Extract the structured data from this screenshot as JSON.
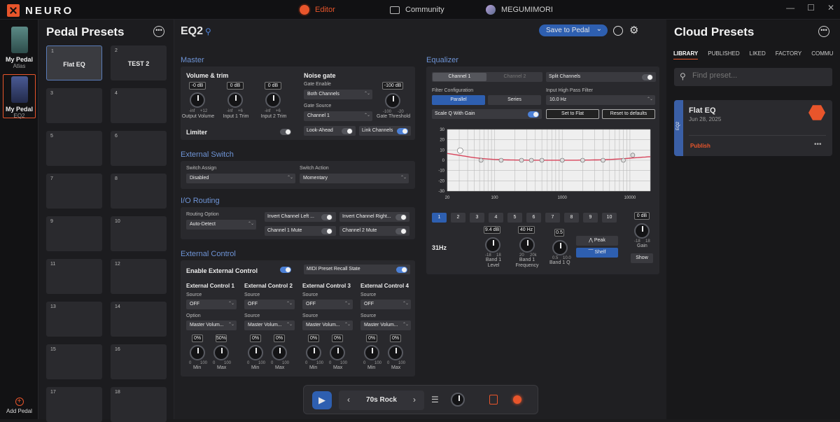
{
  "app": {
    "logo_text": "NEURO",
    "nav": {
      "editor": "Editor",
      "community": "Community",
      "user": "MEGUMIMORI"
    },
    "window": {
      "min": "—",
      "max": "☐",
      "close": "✕"
    }
  },
  "sidebar": {
    "pedals": [
      {
        "name": "My Pedal",
        "sub": "Atlas",
        "color": "#3c6a6a"
      },
      {
        "name": "My Pedal",
        "sub": "EQ2",
        "color": "#2f3c6a"
      }
    ],
    "add_label": "Add Pedal"
  },
  "presets": {
    "title": "Pedal Presets",
    "more": "•••",
    "slots": [
      {
        "n": "1",
        "label": "Flat EQ"
      },
      {
        "n": "2",
        "label": "TEST 2"
      },
      {
        "n": "3",
        "label": ""
      },
      {
        "n": "4",
        "label": ""
      },
      {
        "n": "5",
        "label": ""
      },
      {
        "n": "6",
        "label": ""
      },
      {
        "n": "7",
        "label": ""
      },
      {
        "n": "8",
        "label": ""
      },
      {
        "n": "9",
        "label": ""
      },
      {
        "n": "10",
        "label": ""
      },
      {
        "n": "11",
        "label": ""
      },
      {
        "n": "12",
        "label": ""
      },
      {
        "n": "13",
        "label": ""
      },
      {
        "n": "14",
        "label": ""
      },
      {
        "n": "15",
        "label": ""
      },
      {
        "n": "16",
        "label": ""
      },
      {
        "n": "17",
        "label": ""
      },
      {
        "n": "18",
        "label": ""
      }
    ]
  },
  "header": {
    "title": "EQ2",
    "save": "Save to Pedal",
    "save_arrow": "⌄"
  },
  "master": {
    "title": "Master",
    "vol_title": "Volume & trim",
    "knobs": [
      {
        "value": "-0 dB",
        "label": "Output Volume",
        "min": "-inf",
        "max": "+12"
      },
      {
        "value": "0 dB",
        "label": "Input 1 Trim",
        "min": "-inf",
        "max": "+6"
      },
      {
        "value": "0 dB",
        "label": "Input 2 Trim",
        "min": "-inf",
        "max": "+6"
      }
    ],
    "limiter": "Limiter",
    "noise_gate": "Noise gate",
    "gate_enable": "Gate Enable",
    "gate_enable_val": "Both Channels",
    "gate_source": "Gate Source",
    "gate_source_val": "Channel 1",
    "threshold_val": "-100 dB",
    "threshold_label": "Gate Threshold",
    "threshold_min": "-100",
    "threshold_max": "-20",
    "lookahead": "Look-Ahead",
    "link": "Link Channels"
  },
  "ext_switch": {
    "title": "External Switch",
    "assign": "Switch Assign",
    "assign_val": "Disabled",
    "action": "Switch Action",
    "action_val": "Momentary"
  },
  "io": {
    "title": "I/O Routing",
    "option": "Routing Option",
    "option_val": "Auto-Detect",
    "t1": "Invert Channel Left ...",
    "t2": "Invert Channel Right...",
    "t3": "Channel 1 Mute",
    "t4": "Channel 2 Mute"
  },
  "ext_ctrl": {
    "title": "External Control",
    "enable": "Enable External Control",
    "midi": "MIDI Preset Recall State",
    "cols": [
      {
        "title": "External Control 1",
        "src": "Source",
        "src_val": "OFF",
        "opt": "Option",
        "opt_val": "Master Volum...",
        "k1": "0%",
        "k2": "50%"
      },
      {
        "title": "External Control 2",
        "src": "Source",
        "src_val": "OFF",
        "opt": "Source",
        "opt_val": "Master Volum...",
        "k1": "0%",
        "k2": "0%"
      },
      {
        "title": "External Control 3",
        "src": "Source",
        "src_val": "OFF",
        "opt": "Source",
        "opt_val": "Master Volum...",
        "k1": "0%",
        "k2": "0%"
      },
      {
        "title": "External Control 4",
        "src": "Source",
        "src_val": "OFF",
        "opt": "Source",
        "opt_val": "Master Volum...",
        "k1": "0%",
        "k2": "0%"
      }
    ],
    "min": "Min",
    "max": "Max",
    "kmin": "0",
    "kmax": "100"
  },
  "eq": {
    "title": "Equalizer",
    "ch1": "Channel 1",
    "ch2": "Channel 2",
    "split": "Split Channels",
    "filter_cfg": "Filter Configuration",
    "parallel": "Parallel",
    "series": "Series",
    "hpf": "Input High Pass Filter",
    "hpf_val": "10.0 Hz",
    "scale_q": "Scale Q With Gain",
    "flat": "Set to Flat",
    "reset": "Reset to defaults",
    "bands": [
      "1",
      "2",
      "3",
      "4",
      "5",
      "6",
      "7",
      "8",
      "9",
      "10"
    ],
    "gain_val": "0 dB",
    "gain_label": "Gain",
    "gain_min": "-18",
    "gain_max": "18",
    "show": "Show",
    "freq_label": "31Hz",
    "level_val": "9.4 dB",
    "level_label": "Band 1 Level",
    "level_min": "-18",
    "level_max": "18",
    "freq_val": "40 Hz",
    "freq_knob_label": "Band 1 Frequency",
    "freq_min": "20",
    "freq_max": "20k",
    "q_val": "0.5",
    "q_label": "Band 1 Q",
    "q_min": "0.5",
    "q_max": "10.0",
    "peak": "Peak",
    "shelf": "Shelf"
  },
  "chart_data": {
    "type": "line",
    "x": [
      31,
      63,
      125,
      250,
      350,
      500,
      1000,
      2000,
      4000,
      8000,
      11000
    ],
    "values": [
      9.4,
      0,
      0,
      0,
      0,
      0,
      0,
      0,
      0,
      0,
      5
    ],
    "xscale": "log",
    "xlim": [
      20,
      20000
    ],
    "ylim": [
      -30,
      30
    ],
    "yticks": [
      "30",
      "20",
      "10",
      "0",
      "-10",
      "-20",
      "-30"
    ],
    "xticks": [
      "20",
      "100",
      "1000",
      "10000"
    ],
    "grid": true,
    "curve_color": "#d8435a"
  },
  "cloud": {
    "title": "Cloud Presets",
    "tabs": [
      "LIBRARY",
      "PUBLISHED",
      "LIKED",
      "FACTORY",
      "COMMU"
    ],
    "search_placeholder": "Find preset...",
    "card": {
      "title": "Flat EQ",
      "date": "Jun 28, 2025",
      "tag": "EQ2",
      "publish": "Publish",
      "more": "•••"
    }
  },
  "transport": {
    "preset": "70s Rock"
  }
}
